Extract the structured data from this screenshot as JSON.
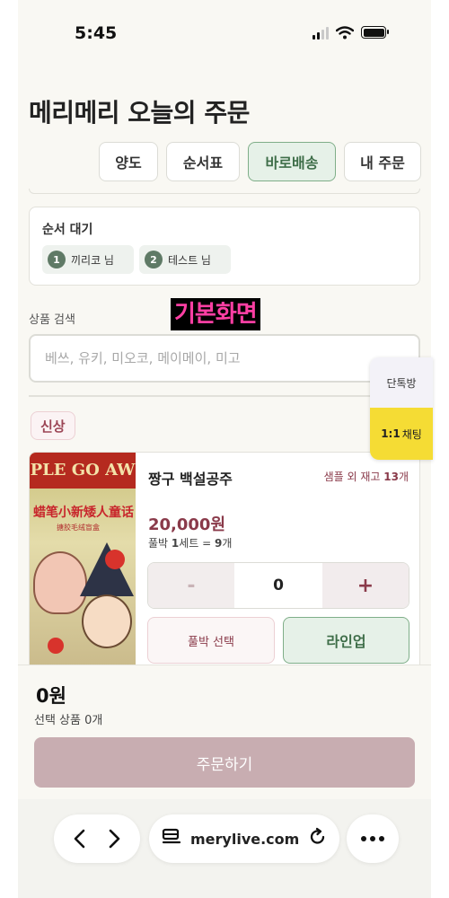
{
  "status_bar": {
    "time": "5:45"
  },
  "page": {
    "title": "메리메리 오늘의 주문"
  },
  "tabs": [
    {
      "label": "양도",
      "active": false
    },
    {
      "label": "순서표",
      "active": false
    },
    {
      "label": "바로배송",
      "active": true
    },
    {
      "label": "내 주문",
      "active": false
    }
  ],
  "queue": {
    "title": "순서 대기",
    "items": [
      {
        "num": "1",
        "name": "끼리코 님"
      },
      {
        "num": "2",
        "name": "테스트 님"
      }
    ]
  },
  "overlay_label": "기본화면",
  "search": {
    "label": "상품 검색",
    "placeholder": "베쓰, 유키, 미오코, 메이메이, 미고"
  },
  "section": {
    "badge": "신상"
  },
  "product": {
    "name": "짱구 백설공주",
    "stock_prefix": "샘플 외 재고 ",
    "stock_count": "13",
    "stock_suffix": "개",
    "price": "20,000원",
    "set_prefix": "풀박 ",
    "set_count": "1",
    "set_mid": "세트 = ",
    "set_pieces": "9",
    "set_suffix": "개",
    "quantity": "0",
    "minus_label": "-",
    "plus_label": "+",
    "full_select_label": "풀박 선택",
    "lineup_label": "라인업",
    "image_banner": "PLE GO AW",
    "image_subtitle": "蜡笔小新矮人童话",
    "image_subsub": "搪胶毛绒盲盒"
  },
  "floating": {
    "open_chat": "단톡방",
    "chat_bold": "1:1",
    "chat_label": "채팅"
  },
  "summary": {
    "total": "0원",
    "count": "선택 상품 0개",
    "order_button": "주문하기"
  },
  "browser": {
    "url": "merylive.com"
  },
  "colors": {
    "accent_green": "#3f6e49",
    "accent_wine": "#8a3a4a",
    "chat_yellow": "#f5dc34",
    "order_button": "#c8adb1"
  }
}
